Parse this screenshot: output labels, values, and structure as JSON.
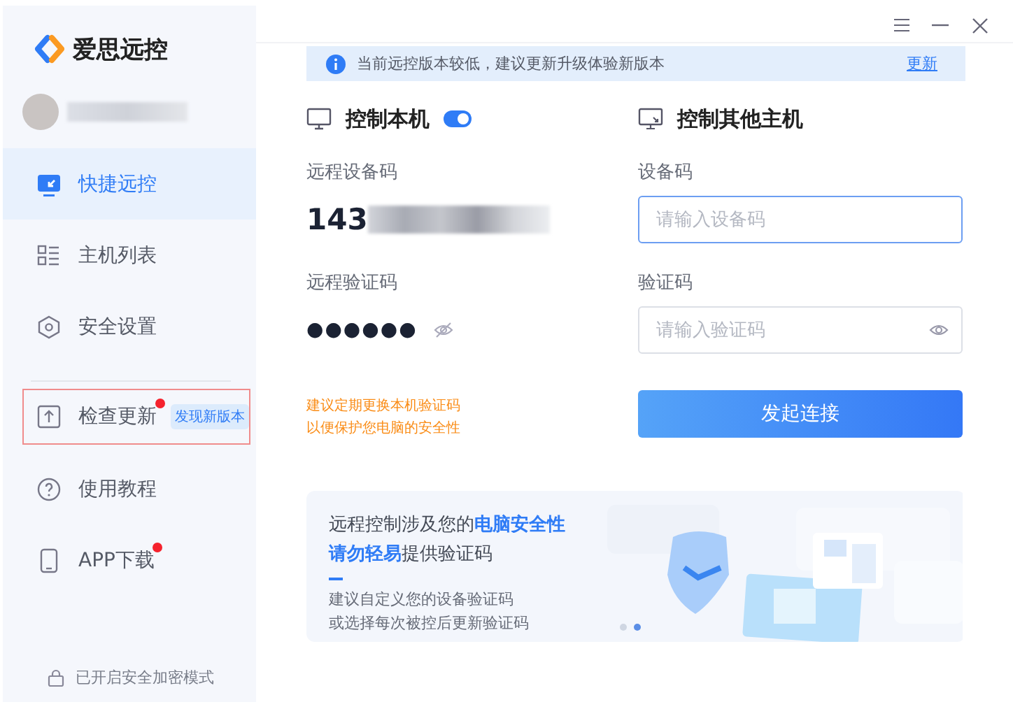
{
  "app": {
    "name": "爱思远控"
  },
  "sidebar": {
    "groups": [
      {
        "items": [
          {
            "label": "快捷远控",
            "kind": "monitor",
            "selected": true,
            "dot": false,
            "highlighted": false
          },
          {
            "label": "主机列表",
            "kind": "list",
            "selected": false,
            "dot": false,
            "highlighted": false
          },
          {
            "label": "安全设置",
            "kind": "security",
            "selected": false,
            "dot": false,
            "highlighted": false
          }
        ]
      },
      {
        "items": [
          {
            "label": "检查更新",
            "kind": "update",
            "selected": false,
            "dot": true,
            "badge": "发现新版本",
            "highlighted": true
          },
          {
            "label": "使用教程",
            "kind": "help",
            "selected": false,
            "dot": false,
            "highlighted": false
          },
          {
            "label": "APP下载",
            "kind": "phone",
            "selected": false,
            "dot": true,
            "highlighted": false
          }
        ]
      }
    ],
    "footer": "已开启安全加密模式"
  },
  "notice": {
    "text": "当前远控版本较低，建议更新升级体验新版本",
    "link": "更新"
  },
  "local": {
    "title": "控制本机",
    "toggle_on": true,
    "device_code_label": "远程设备码",
    "device_code": "143",
    "verify_label": "远程验证码",
    "verify_code": "●●●●●●",
    "tip": [
      "建议定期更换本机验证码",
      "以便保护您电脑的安全性"
    ]
  },
  "remote": {
    "title": "控制其他主机",
    "device_label": "设备码",
    "device_placeholder": "请输入设备码",
    "device_focused": true,
    "verify_label": "验证码",
    "verify_placeholder": "请输入验证码",
    "connect": "发起连接"
  },
  "carousel": {
    "lines": [
      "远程控制涉及您的**电脑安全性**",
      "**请勿轻易**提供验证码"
    ],
    "sub": [
      "建议自定义您的设备验证码",
      "或选择每次被控后更新验证码"
    ],
    "dots": [
      {
        "selected": false
      },
      {
        "selected": true
      }
    ]
  }
}
